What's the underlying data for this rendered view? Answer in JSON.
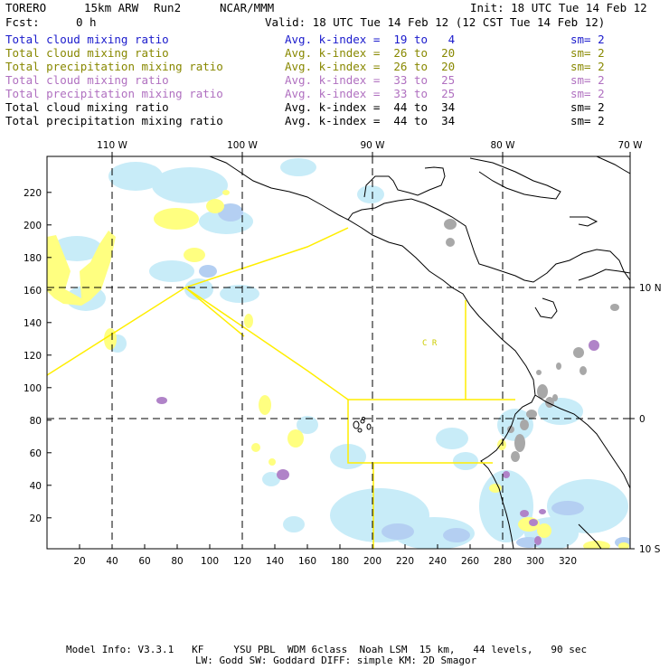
{
  "header": {
    "model": "TORERO",
    "resolution": "15km ARW",
    "run": "Run2",
    "org": "NCAR/MMM",
    "init": "Init: 18 UTC Tue 14 Feb 12",
    "fcst_label": "Fcst:",
    "fcst_value": "0 h",
    "valid": "Valid: 18 UTC Tue 14 Feb 12 (12 CST Tue 14 Feb 12)"
  },
  "legend": [
    {
      "field": "Total cloud mixing ratio",
      "range": "Avg. k-index =  19 to   4",
      "smooth": "sm= 2",
      "color": "#1a1acc"
    },
    {
      "field": "Total cloud mixing ratio",
      "range": "Avg. k-index =  26 to  20",
      "smooth": "sm= 2",
      "color": "#888800"
    },
    {
      "field": "Total precipitation mixing ratio",
      "range": "Avg. k-index =  26 to  20",
      "smooth": "sm= 2",
      "color": "#888800"
    },
    {
      "field": "Total cloud mixing ratio",
      "range": "Avg. k-index =  33 to  25",
      "smooth": "sm= 2",
      "color": "#b070c0"
    },
    {
      "field": "Total precipitation mixing ratio",
      "range": "Avg. k-index =  33 to  25",
      "smooth": "sm= 2",
      "color": "#b070c0"
    },
    {
      "field": "Total cloud mixing ratio",
      "range": "Avg. k-index =  44 to  34",
      "smooth": "sm= 2",
      "color": "#000000"
    },
    {
      "field": "Total precipitation mixing ratio",
      "range": "Avg. k-index =  44 to  34",
      "smooth": "sm= 2",
      "color": "#000000"
    }
  ],
  "map": {
    "lon_labels": [
      "110 W",
      "100 W",
      "90 W",
      "80 W",
      "70 W"
    ],
    "lat_labels": [
      "10 N",
      "0",
      "10 S"
    ],
    "x_ticks": [
      "20",
      "40",
      "60",
      "80",
      "100",
      "120",
      "140",
      "160",
      "180",
      "200",
      "220",
      "240",
      "260",
      "280",
      "300",
      "320"
    ],
    "y_ticks": [
      "20",
      "40",
      "60",
      "80",
      "100",
      "120",
      "140",
      "160",
      "180",
      "200",
      "220"
    ],
    "annotation": "C R",
    "colors": {
      "low_cloud": "#c8ecf8",
      "low_cloud_2": "#b4cff2",
      "mid": "#ffff80",
      "mid_high": "#b083c8",
      "high": "#a8a8a8",
      "domain_box": "#ffee00"
    }
  },
  "footer": {
    "line1": "Model Info: V3.3.1   KF     YSU PBL  WDM 6class  Noah LSM  15 km,   44 levels,   90 sec",
    "line2": "LW: Godd SW: Goddard DIFF: simple KM: 2D Smagor"
  }
}
